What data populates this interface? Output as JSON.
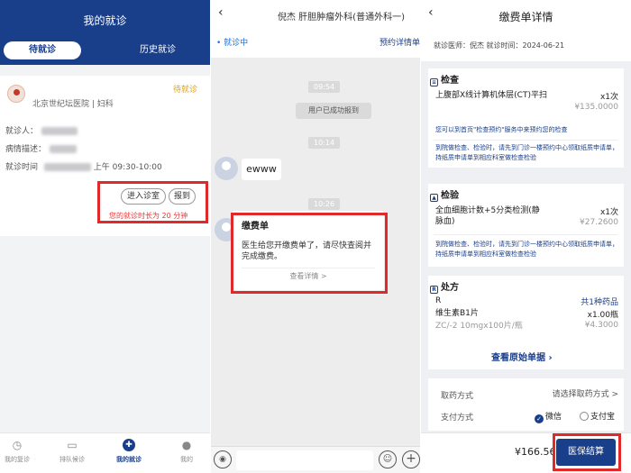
{
  "p1": {
    "title": "我的就诊",
    "tab_active": "待就诊",
    "tab_other": "历史就诊",
    "status": "待就诊",
    "hospital": "北京世纪坛医院 | 妇科",
    "label_patient": "就诊人",
    "label_desc": "病情描述",
    "label_time": "就诊时间",
    "time_value": "上午 09:30-10:00",
    "btn_enter": "进入诊室",
    "btn_report": "报到",
    "duration": "您的就诊时长为 20 分钟",
    "tabs": [
      "我的复诊",
      "排队候诊",
      "我的就诊",
      "我的"
    ]
  },
  "p2": {
    "doctor": "倪杰   肝胆肿瘤外科(普通外科一)",
    "live": "• 就诊中",
    "detail_link": "预约详情单",
    "times": [
      "09:54",
      "10:14",
      "10:26"
    ],
    "system_msg": "用户已成功报到",
    "user_msg": "ewww",
    "card_title": "缴费单",
    "card_body": "医生给您开缴费单了，请尽快查阅并完成缴费。",
    "card_link": "查看详情 >"
  },
  "p3": {
    "title": "缴费单详情",
    "sub": "就诊医师：倪杰   就诊时间：2024-06-21",
    "sec_exam": {
      "heading": "检查",
      "item": "上腹部X线计算机体层(CT)平扫",
      "qty": "x1次",
      "price": "¥135.0000",
      "note1": "您可以到首页\"检查预约\"服务中来预约您的检查",
      "note2": "到院做检查、检验时，请先到门诊一楼预约中心领取纸质申请单，持纸质申请单到相应科室做检查检验"
    },
    "sec_lab": {
      "heading": "检验",
      "item": "全血细胞计数+5分类检测(静脉血)",
      "qty": "x1次",
      "price": "¥27.2600",
      "note": "到院做检查、检验时，请先到门诊一楼预约中心领取纸质申请单，持纸质申请单到相应科室做检查检验"
    },
    "sec_rx": {
      "heading": "处方",
      "r": "R",
      "count": "共1种药品",
      "drug": "维生素B1片",
      "qty": "x1.00瓶",
      "spec": "ZC/-2 10mgx100片/瓶",
      "price": "¥4.3000"
    },
    "view_original": "查看原始单据 ›",
    "pickup_label": "取药方式",
    "pickup_value": "请选择取药方式 >",
    "pay_label": "支付方式",
    "pay_wechat": "微信",
    "pay_alipay": "支付宝",
    "total": "¥166.56",
    "pay_button": "医保结算"
  },
  "colors": {
    "primary": "#1a3f8a",
    "alert": "#e02a2a",
    "pending": "#e0a020"
  }
}
